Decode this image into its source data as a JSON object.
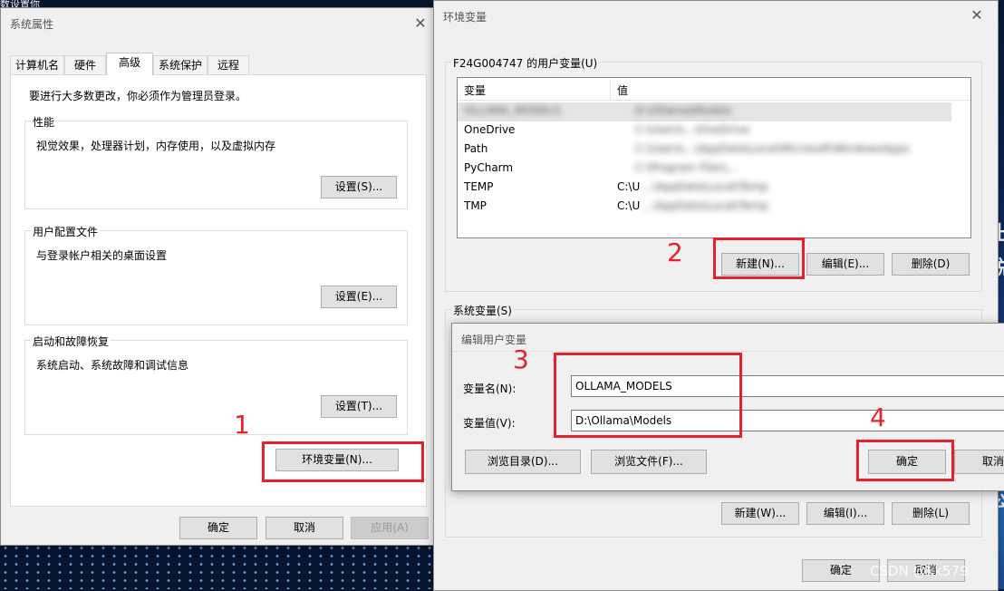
{
  "desktop": {
    "top_partial_text": "数设置你",
    "side_glyphs": [
      "出",
      "鋭",
      "公"
    ]
  },
  "sys_props": {
    "title": "系统属性",
    "tabs": [
      "计算机名",
      "硬件",
      "高级",
      "系统保护",
      "远程"
    ],
    "active_tab": "高级",
    "admin_notice": "要进行大多数更改，你必须作为管理员登录。",
    "performance": {
      "label": "性能",
      "desc": "视觉效果，处理器计划，内存使用，以及虚拟内存",
      "button": "设置(S)..."
    },
    "user_profile": {
      "label": "用户配置文件",
      "desc": "与登录帐户相关的桌面设置",
      "button": "设置(E)..."
    },
    "startup": {
      "label": "启动和故障恢复",
      "desc": "系统启动、系统故障和调试信息",
      "button": "设置(T)..."
    },
    "env_button": "环境变量(N)...",
    "footer": {
      "ok": "确定",
      "cancel": "取消",
      "apply": "应用(A)"
    }
  },
  "env_vars": {
    "title": "环境变量",
    "user_group_label": "F24G004747 的用户变量(U)",
    "columns": {
      "var": "变量",
      "val": "值"
    },
    "user_rows": [
      {
        "name": "OLLAMA_MODELS",
        "value": "D:\\Ollama\\Models",
        "blurred_name": true,
        "blurred_value": true
      },
      {
        "name": "OneDrive",
        "value": "C:\\Users\\...\\OneDrive",
        "blurred_name": false,
        "blurred_value": true
      },
      {
        "name": "Path",
        "value": "C:\\Users\\...\\AppData\\Local\\Microsoft\\WindowsApps",
        "blurred_name": false,
        "blurred_value": true
      },
      {
        "name": "PyCharm",
        "value": "C:\\Program Files\\...",
        "blurred_name": false,
        "blurred_value": true
      },
      {
        "name": "TEMP",
        "value": "C:\\U",
        "value_tail": "...\\AppData\\Local\\Temp",
        "blurred_name": false,
        "blurred_value": false
      },
      {
        "name": "TMP",
        "value": "C:\\U",
        "value_tail": "...\\AppData\\Local\\Temp",
        "blurred_name": false,
        "blurred_value": false
      }
    ],
    "user_buttons": {
      "new": "新建(N)...",
      "edit": "编辑(E)...",
      "delete": "删除(D)"
    },
    "system_group_label": "系统变量(S)",
    "system_buttons": {
      "new": "新建(W)...",
      "edit": "编辑(I)...",
      "delete": "删除(L)"
    },
    "footer": {
      "ok": "确定",
      "cancel": "取消"
    }
  },
  "edit_dialog": {
    "title": "编辑用户变量",
    "name_label": "变量名(N):",
    "name_value": "OLLAMA_MODELS",
    "value_label": "变量值(V):",
    "value_value": "D:\\Ollama\\Models",
    "browse_dir": "浏览目录(D)...",
    "browse_file": "浏览文件(F)...",
    "ok": "确定",
    "cancel": "取消"
  },
  "annotations": {
    "step1": "1",
    "step2": "2",
    "step3": "3",
    "step4": "4",
    "color": "#e8202a"
  },
  "watermark": "CSDN @kk579"
}
